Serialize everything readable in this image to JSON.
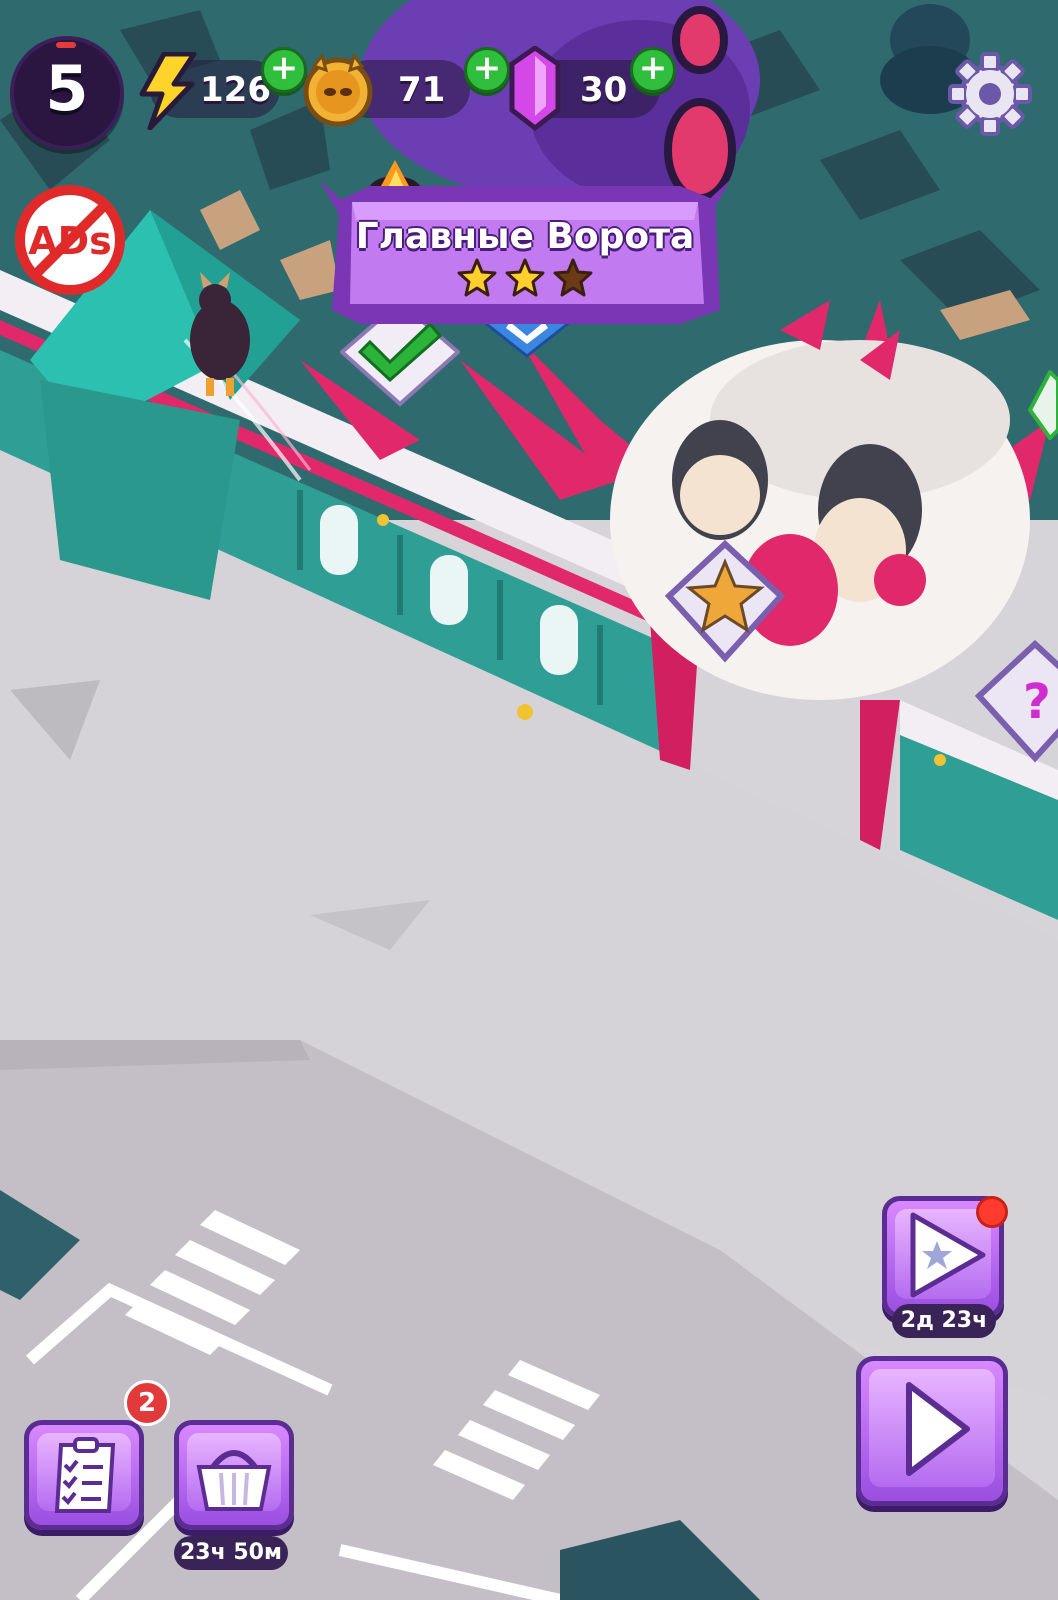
{
  "hud": {
    "level": "5",
    "energy": "126",
    "coins": "71",
    "gems": "30",
    "plus_label": "+"
  },
  "location": {
    "title": "Главные Ворота",
    "stars_earned": 2,
    "stars_total": 3
  },
  "buttons": {
    "tasks_badge": "2",
    "shop_timer": "23ч 50м",
    "event_timer": "2д 23ч"
  },
  "icons": {
    "energy": "lightning-icon",
    "coin": "skull-coin-icon",
    "gem": "crystal-icon",
    "settings": "gear-icon",
    "no_ads": "no-ads-icon",
    "tasks": "clipboard-icon",
    "shop": "basket-icon",
    "event": "star-play-icon",
    "play": "play-icon"
  },
  "colors": {
    "accent_purple": "#a45ae6",
    "plus_green": "#2fbf3c",
    "badge_red": "#e23a3a",
    "wall_teal": "#2f9e95",
    "wall_pink": "#e0286b"
  }
}
